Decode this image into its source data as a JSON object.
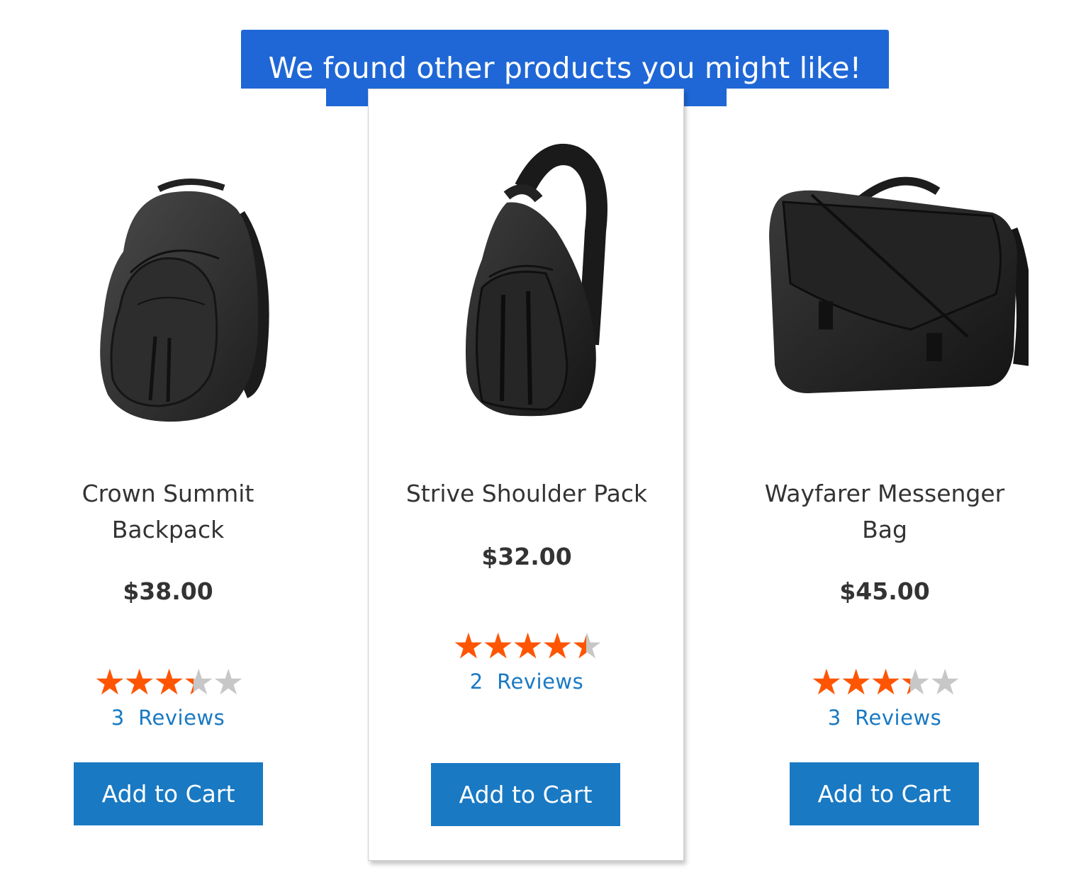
{
  "banner": {
    "text": "We found other products you might like!"
  },
  "products": [
    {
      "name": "Crown Summit Backpack",
      "price": "$38.00",
      "rating_percent": 67,
      "review_count": "3",
      "reviews_label": "Reviews",
      "button_label": "Add to Cart",
      "image": "backpack-image"
    },
    {
      "name": "Strive Shoulder Pack",
      "price": "$32.00",
      "rating_percent": 90,
      "review_count": "2",
      "reviews_label": "Reviews",
      "button_label": "Add to Cart",
      "image": "shoulder-pack-image"
    },
    {
      "name": "Wayfarer Messenger Bag",
      "price": "$45.00",
      "rating_percent": 67,
      "review_count": "3",
      "reviews_label": "Reviews",
      "button_label": "Add to Cart",
      "image": "messenger-bag-image"
    }
  ],
  "colors": {
    "banner_bg": "#1f67d6",
    "button_bg": "#1979c3",
    "star_filled": "#ff5501",
    "star_empty": "#c7c7c7",
    "link": "#1979c3"
  }
}
